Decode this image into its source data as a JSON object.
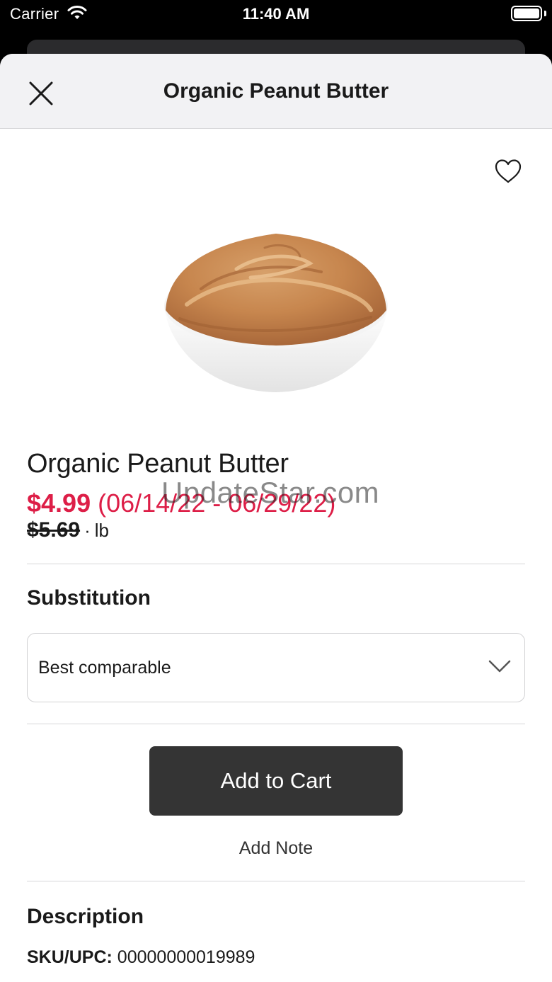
{
  "status_bar": {
    "carrier": "Carrier",
    "time": "11:40 AM"
  },
  "header": {
    "title": "Organic Peanut Butter",
    "close_icon": "close-icon"
  },
  "product": {
    "name": "Organic Peanut Butter",
    "sale_price": "$4.99",
    "sale_dates": "(06/14/22 - 06/29/22)",
    "regular_price": "$5.69",
    "unit_separator": "·",
    "unit": "lb",
    "favorite_icon": "heart-outline-icon",
    "image": "peanut-butter-bowl"
  },
  "watermark": "UpdateStar.com",
  "substitution": {
    "heading": "Substitution",
    "selected": "Best comparable",
    "icon": "chevron-down-icon"
  },
  "actions": {
    "add_to_cart": "Add to Cart",
    "add_note": "Add Note"
  },
  "description": {
    "heading": "Description",
    "sku_label": "SKU/UPC:",
    "sku_value": "00000000019989"
  },
  "colors": {
    "sale_red": "#dd1e47",
    "button_dark": "#343434",
    "header_bg": "#f2f2f4"
  }
}
